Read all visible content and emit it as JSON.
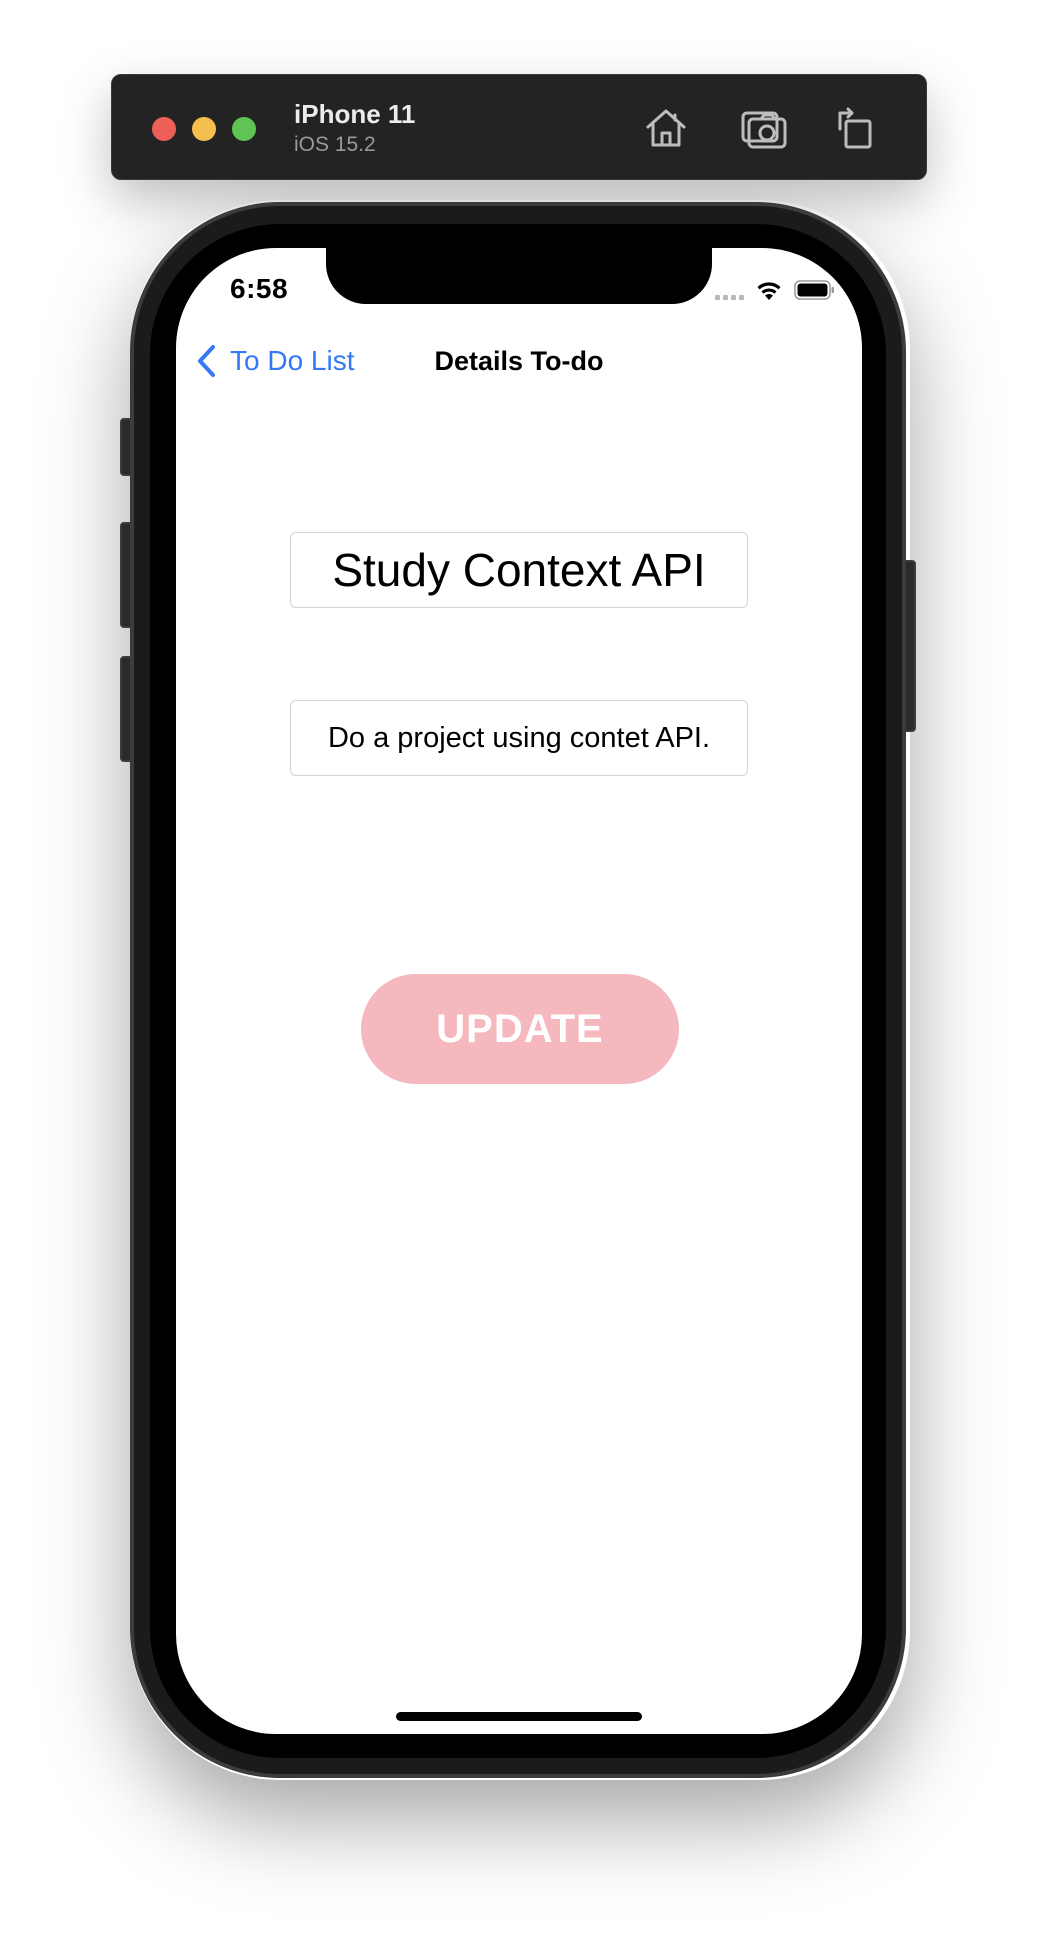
{
  "simulator": {
    "device_name": "iPhone 11",
    "os_version": "iOS 15.2",
    "icons": [
      "home-icon",
      "screenshot-icon",
      "rotate-icon"
    ]
  },
  "status_bar": {
    "time": "6:58",
    "icons": [
      "cellular-signal-icon",
      "wifi-icon",
      "battery-icon"
    ]
  },
  "nav": {
    "back_label": "To Do List",
    "title": "Details To-do",
    "back_icon": "chevron-left-icon"
  },
  "form": {
    "title_value": "Study Context API",
    "description_value": "Do a project using contet API."
  },
  "actions": {
    "update_label": "UPDATE"
  },
  "colors": {
    "accent": "#3478f6",
    "button_bg": "#f4b8be",
    "button_text": "#ffffff"
  }
}
